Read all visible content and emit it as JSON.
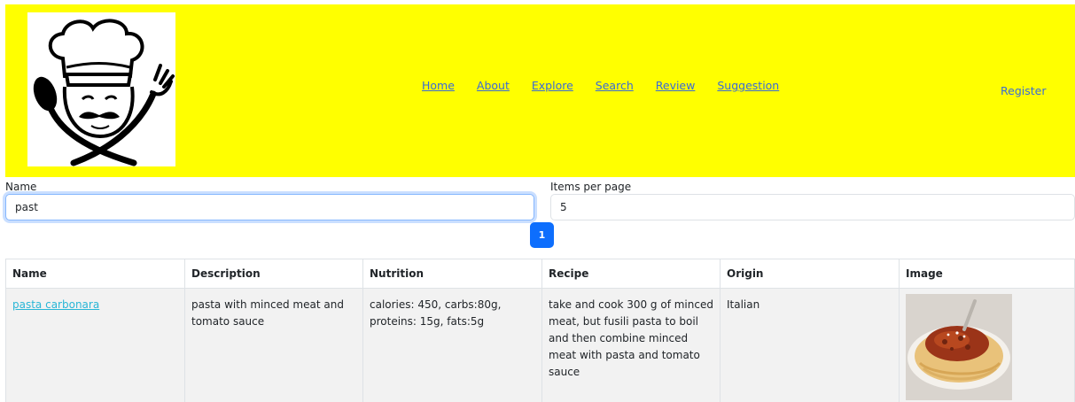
{
  "header": {
    "logo_icon": "chef-logo-icon",
    "nav": [
      "Home",
      "About",
      "Explore",
      "Search",
      "Review",
      "Suggestion"
    ],
    "register": "Register",
    "background": "#ffff00"
  },
  "form": {
    "name_label": "Name",
    "name_value": "past",
    "items_label": "Items per page",
    "items_value": "5"
  },
  "pagination": {
    "current": "1",
    "color": "#0d6efd"
  },
  "table": {
    "headers": [
      "Name",
      "Description",
      "Nutrition",
      "Recipe",
      "Origin",
      "Image"
    ],
    "rows": [
      {
        "name": "pasta carbonara",
        "description": "pasta with minced meat and tomato sauce",
        "nutrition": "calories: 450, carbs:80g, proteins: 15g, fats:5g",
        "recipe": "take and cook 300 g of minced meat, but fusili pasta to boil and then combine minced meat with pasta and tomato sauce",
        "origin": "Italian",
        "image_icon": "pasta-dish-image"
      }
    ]
  }
}
